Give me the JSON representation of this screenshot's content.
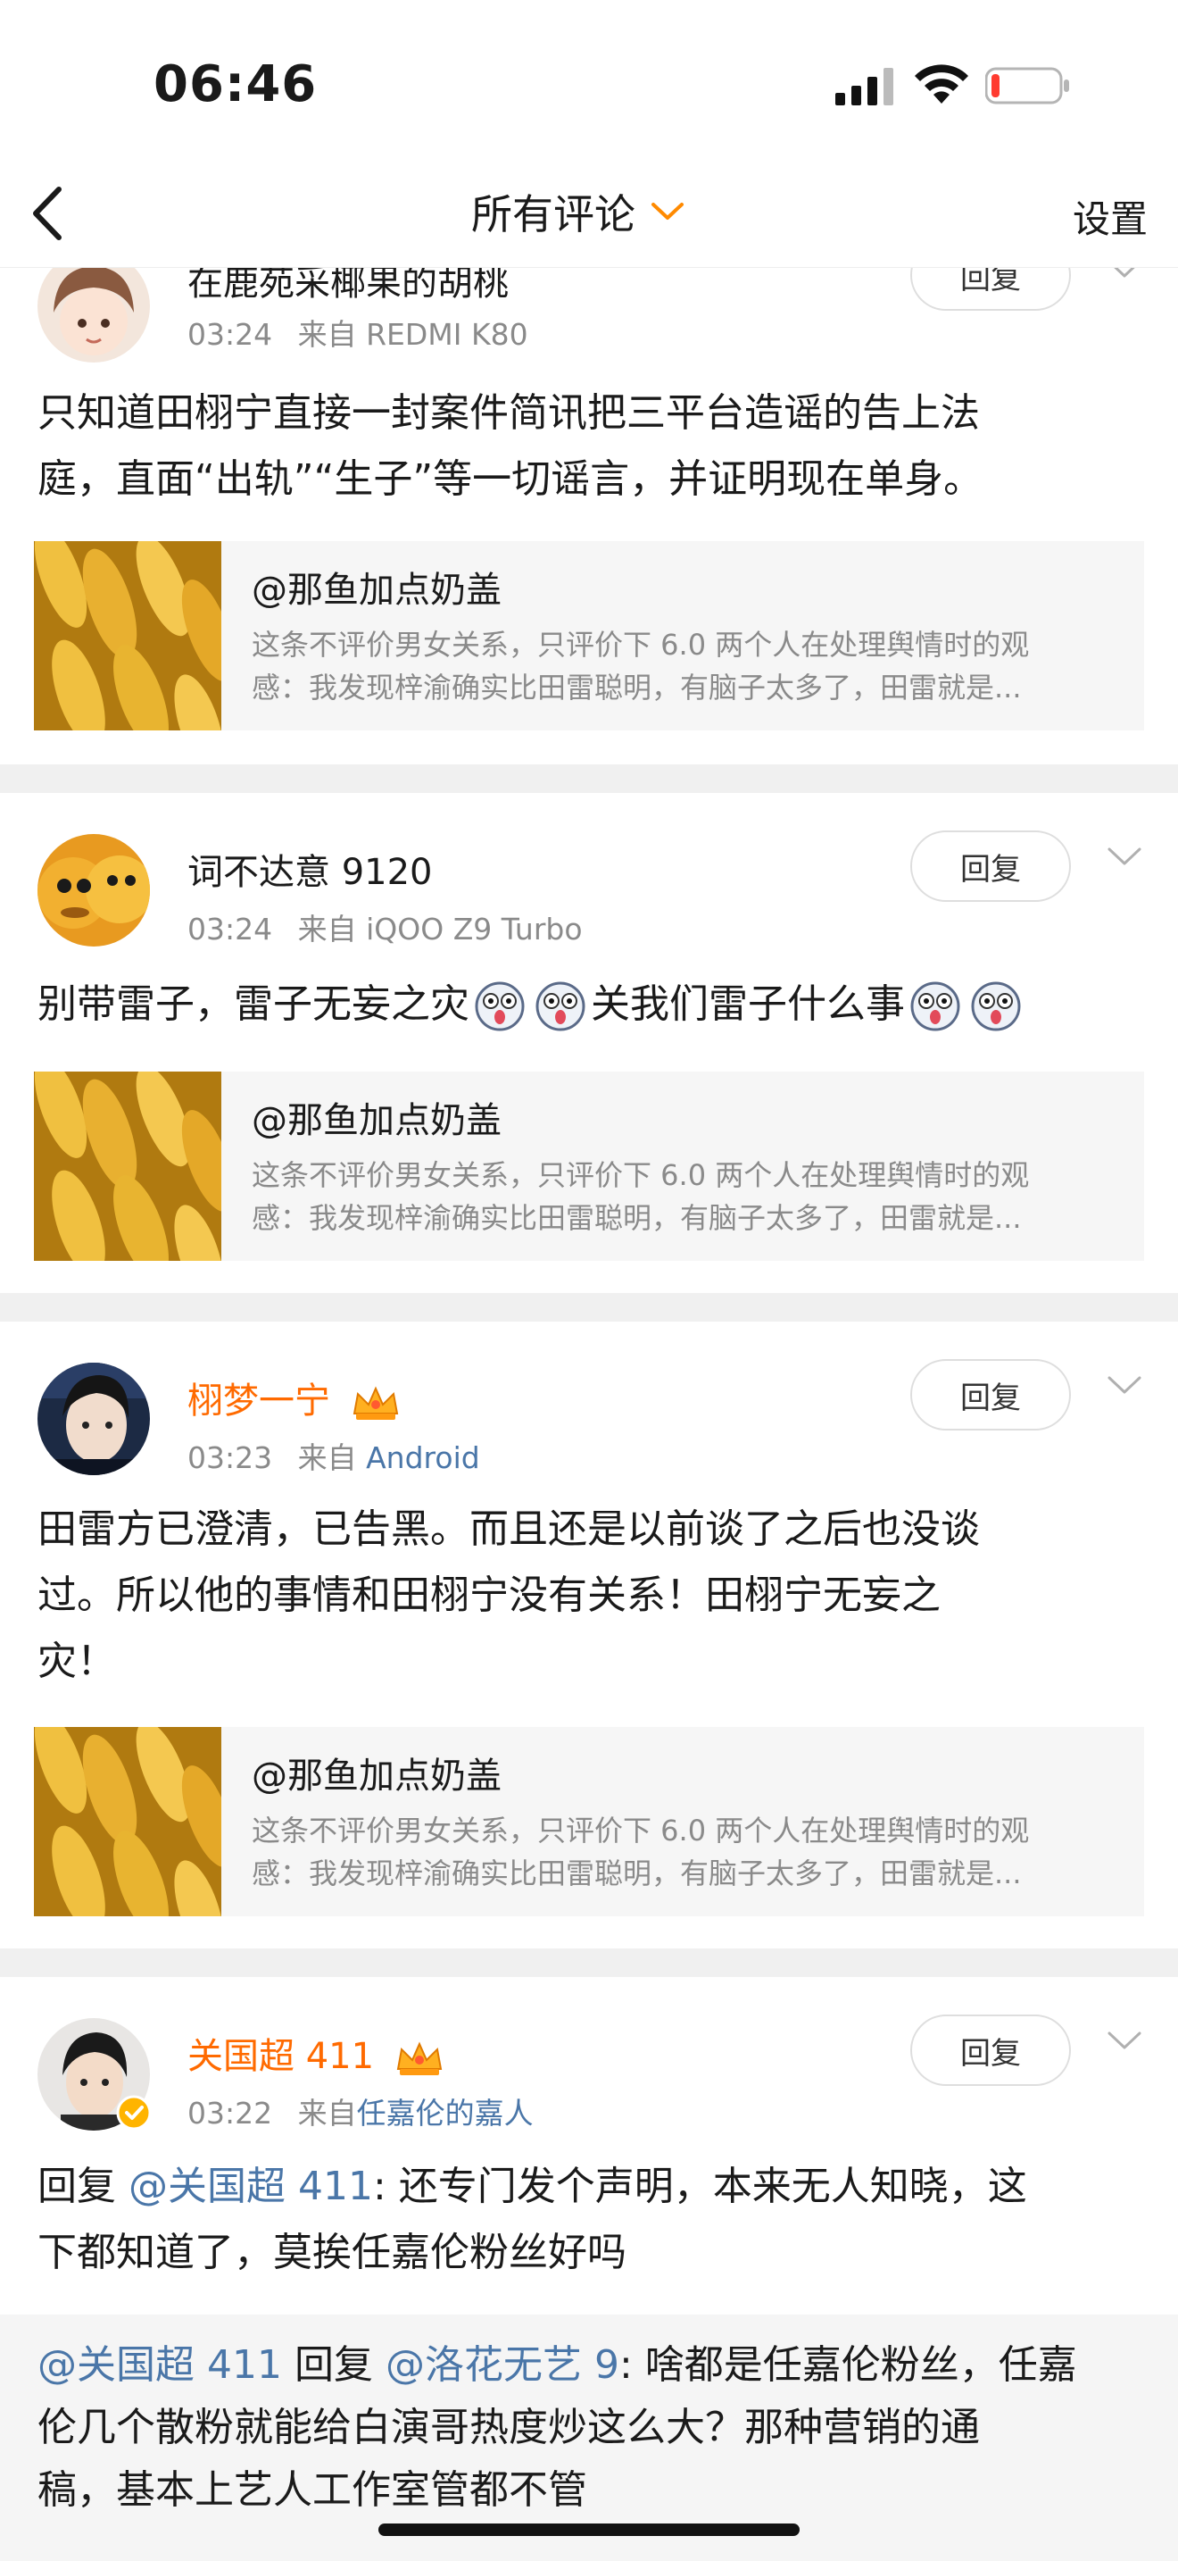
{
  "status_bar": {
    "time": "06:46"
  },
  "nav": {
    "title": "所有评论",
    "settings": "设置"
  },
  "comments": [
    {
      "username": "在鹿苑采椰果的胡桃",
      "time": "03:24",
      "source_prefix": "来自",
      "source": "REDMI K80",
      "reply_label": "回复",
      "lines": [
        "只知道田栩宁直接一封案件简讯把三平台造谣的告上法",
        "庭，直面“出轨”“生子”等一切谣言，并证明现在单身。"
      ],
      "quote": {
        "author": "@那鱼加点奶盖",
        "lines": [
          "这条不评价男女关系，只评价下 6.0 两个人在处理舆情时的观",
          "感：我发现梓渝确实比田雷聪明，有脑子太多了，田雷就是..."
        ]
      }
    },
    {
      "username": "词不达意 9120",
      "time": "03:24",
      "source_prefix": "来自",
      "source": "iQOO Z9 Turbo",
      "reply_label": "回复",
      "text_a": "别带雷子，雷子无妄之灾",
      "text_b": "关我们雷子什么事",
      "quote": {
        "author": "@那鱼加点奶盖",
        "lines": [
          "这条不评价男女关系，只评价下 6.0 两个人在处理舆情时的观",
          "感：我发现梓渝确实比田雷聪明，有脑子太多了，田雷就是..."
        ]
      }
    },
    {
      "username": "栩梦一宁",
      "time": "03:23",
      "source_prefix": "来自",
      "source": "Android",
      "reply_label": "回复",
      "lines": [
        "田雷方已澄清，已告黑。而且还是以前谈了之后也没谈",
        "过。所以他的事情和田栩宁没有关系！田栩宁无妄之",
        "灾！"
      ],
      "quote": {
        "author": "@那鱼加点奶盖",
        "lines": [
          "这条不评价男女关系，只评价下 6.0 两个人在处理舆情时的观",
          "感：我发现梓渝确实比田雷聪明，有脑子太多了，田雷就是..."
        ]
      }
    },
    {
      "username": "关国超 411",
      "time": "03:22",
      "source_prefix": "来自",
      "source": "任嘉伦的嘉人",
      "reply_label": "回复",
      "reply_word": "回复 ",
      "mention": "@关国超 411",
      "line1_rest": ": 还专门发个声明，本来无人知晓，这",
      "line2": "下都知道了，莫挨任嘉伦粉丝好吗"
    }
  ],
  "sub_reply": {
    "mention1": "@关国超 411",
    "reply_word": " 回复 ",
    "mention2": "@洛花无艺 9",
    "line1_rest": ": 啥都是任嘉伦粉丝，任嘉",
    "line2": "伦几个散粉就能给白演哥热度炒这么大？那种营销的通",
    "line3": "稿，基本上艺人工作室管都不管"
  },
  "colors": {
    "accent_orange": "#ff6a00",
    "link_blue": "#4a76a8",
    "muted": "#8a8a8a"
  }
}
